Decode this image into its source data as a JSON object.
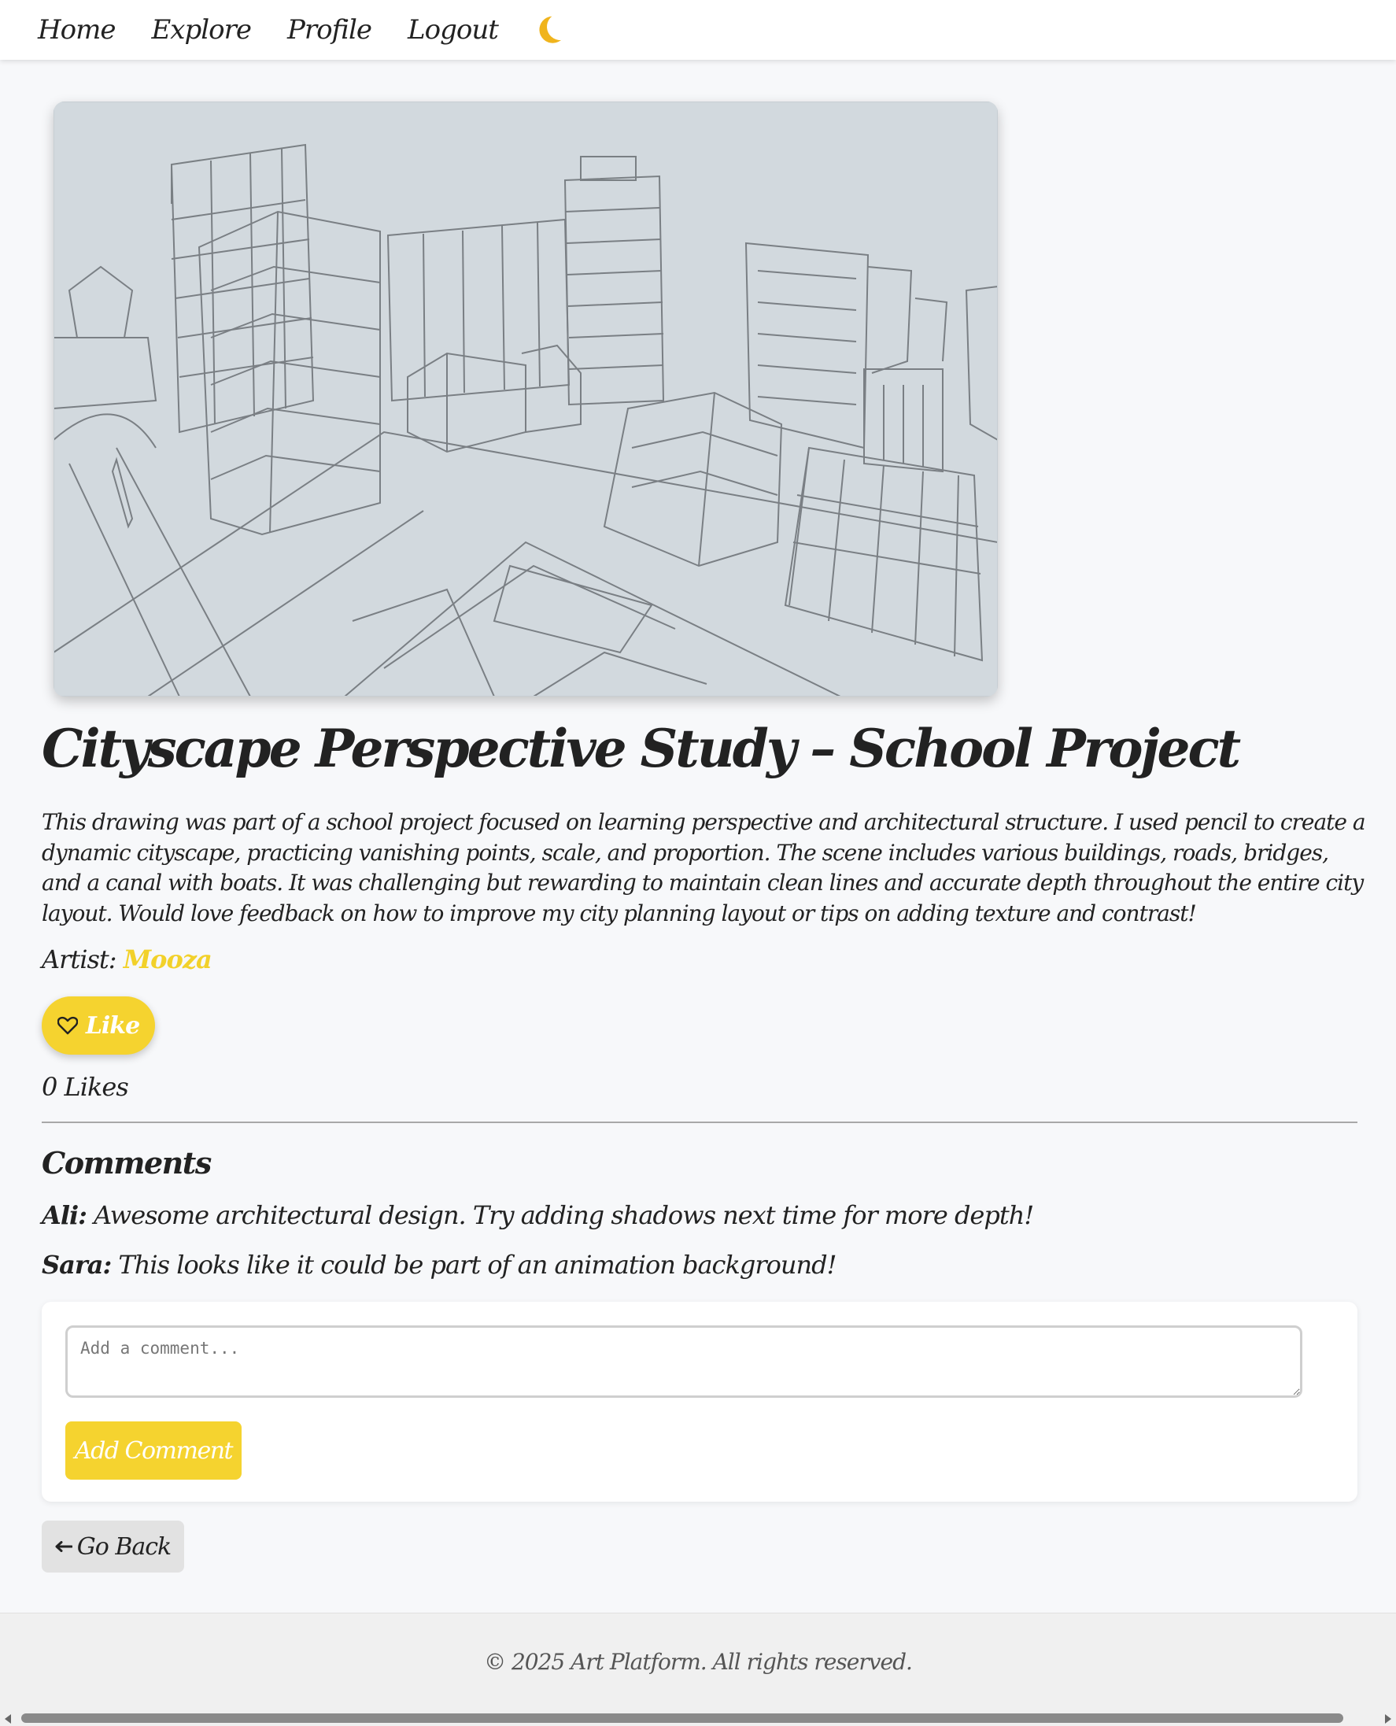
{
  "nav": {
    "items": [
      "Home",
      "Explore",
      "Profile",
      "Logout"
    ],
    "theme_toggle_icon": "moon-icon"
  },
  "artwork": {
    "image_subject": "pencil sketch of a city in perspective",
    "title": "Cityscape Perspective Study – School Project",
    "description": "This drawing was part of a school project focused on learning perspective and architectural structure. I used pencil to create a dynamic cityscape, practicing vanishing points, scale, and proportion. The scene includes various buildings, roads, bridges, and a canal with boats. It was challenging but rewarding to maintain clean lines and accurate depth throughout the entire city layout. Would love feedback on how to improve my city planning layout or tips on adding texture and contrast!",
    "artist_label": "Artist:",
    "artist_name": "Mooza"
  },
  "likes": {
    "button_label": "Like",
    "button_icon": "heart-icon",
    "count_text": "0 Likes"
  },
  "comments": {
    "heading": "Comments",
    "items": [
      {
        "author": "Ali:",
        "text": "Awesome architectural design. Try adding shadows next time for more depth!"
      },
      {
        "author": "Sara:",
        "text": "This looks like it could be part of an animation background!"
      }
    ],
    "input_placeholder": "Add a comment...",
    "submit_label": "Add Comment"
  },
  "go_back": {
    "icon": "left-arrow-icon",
    "label": "Go Back"
  },
  "footer": {
    "text": "© 2025 Art Platform. All rights reserved."
  },
  "colors": {
    "accent": "#f5d32f",
    "artist_link": "#f2d12a",
    "theme_icon": "#f0b41c"
  }
}
